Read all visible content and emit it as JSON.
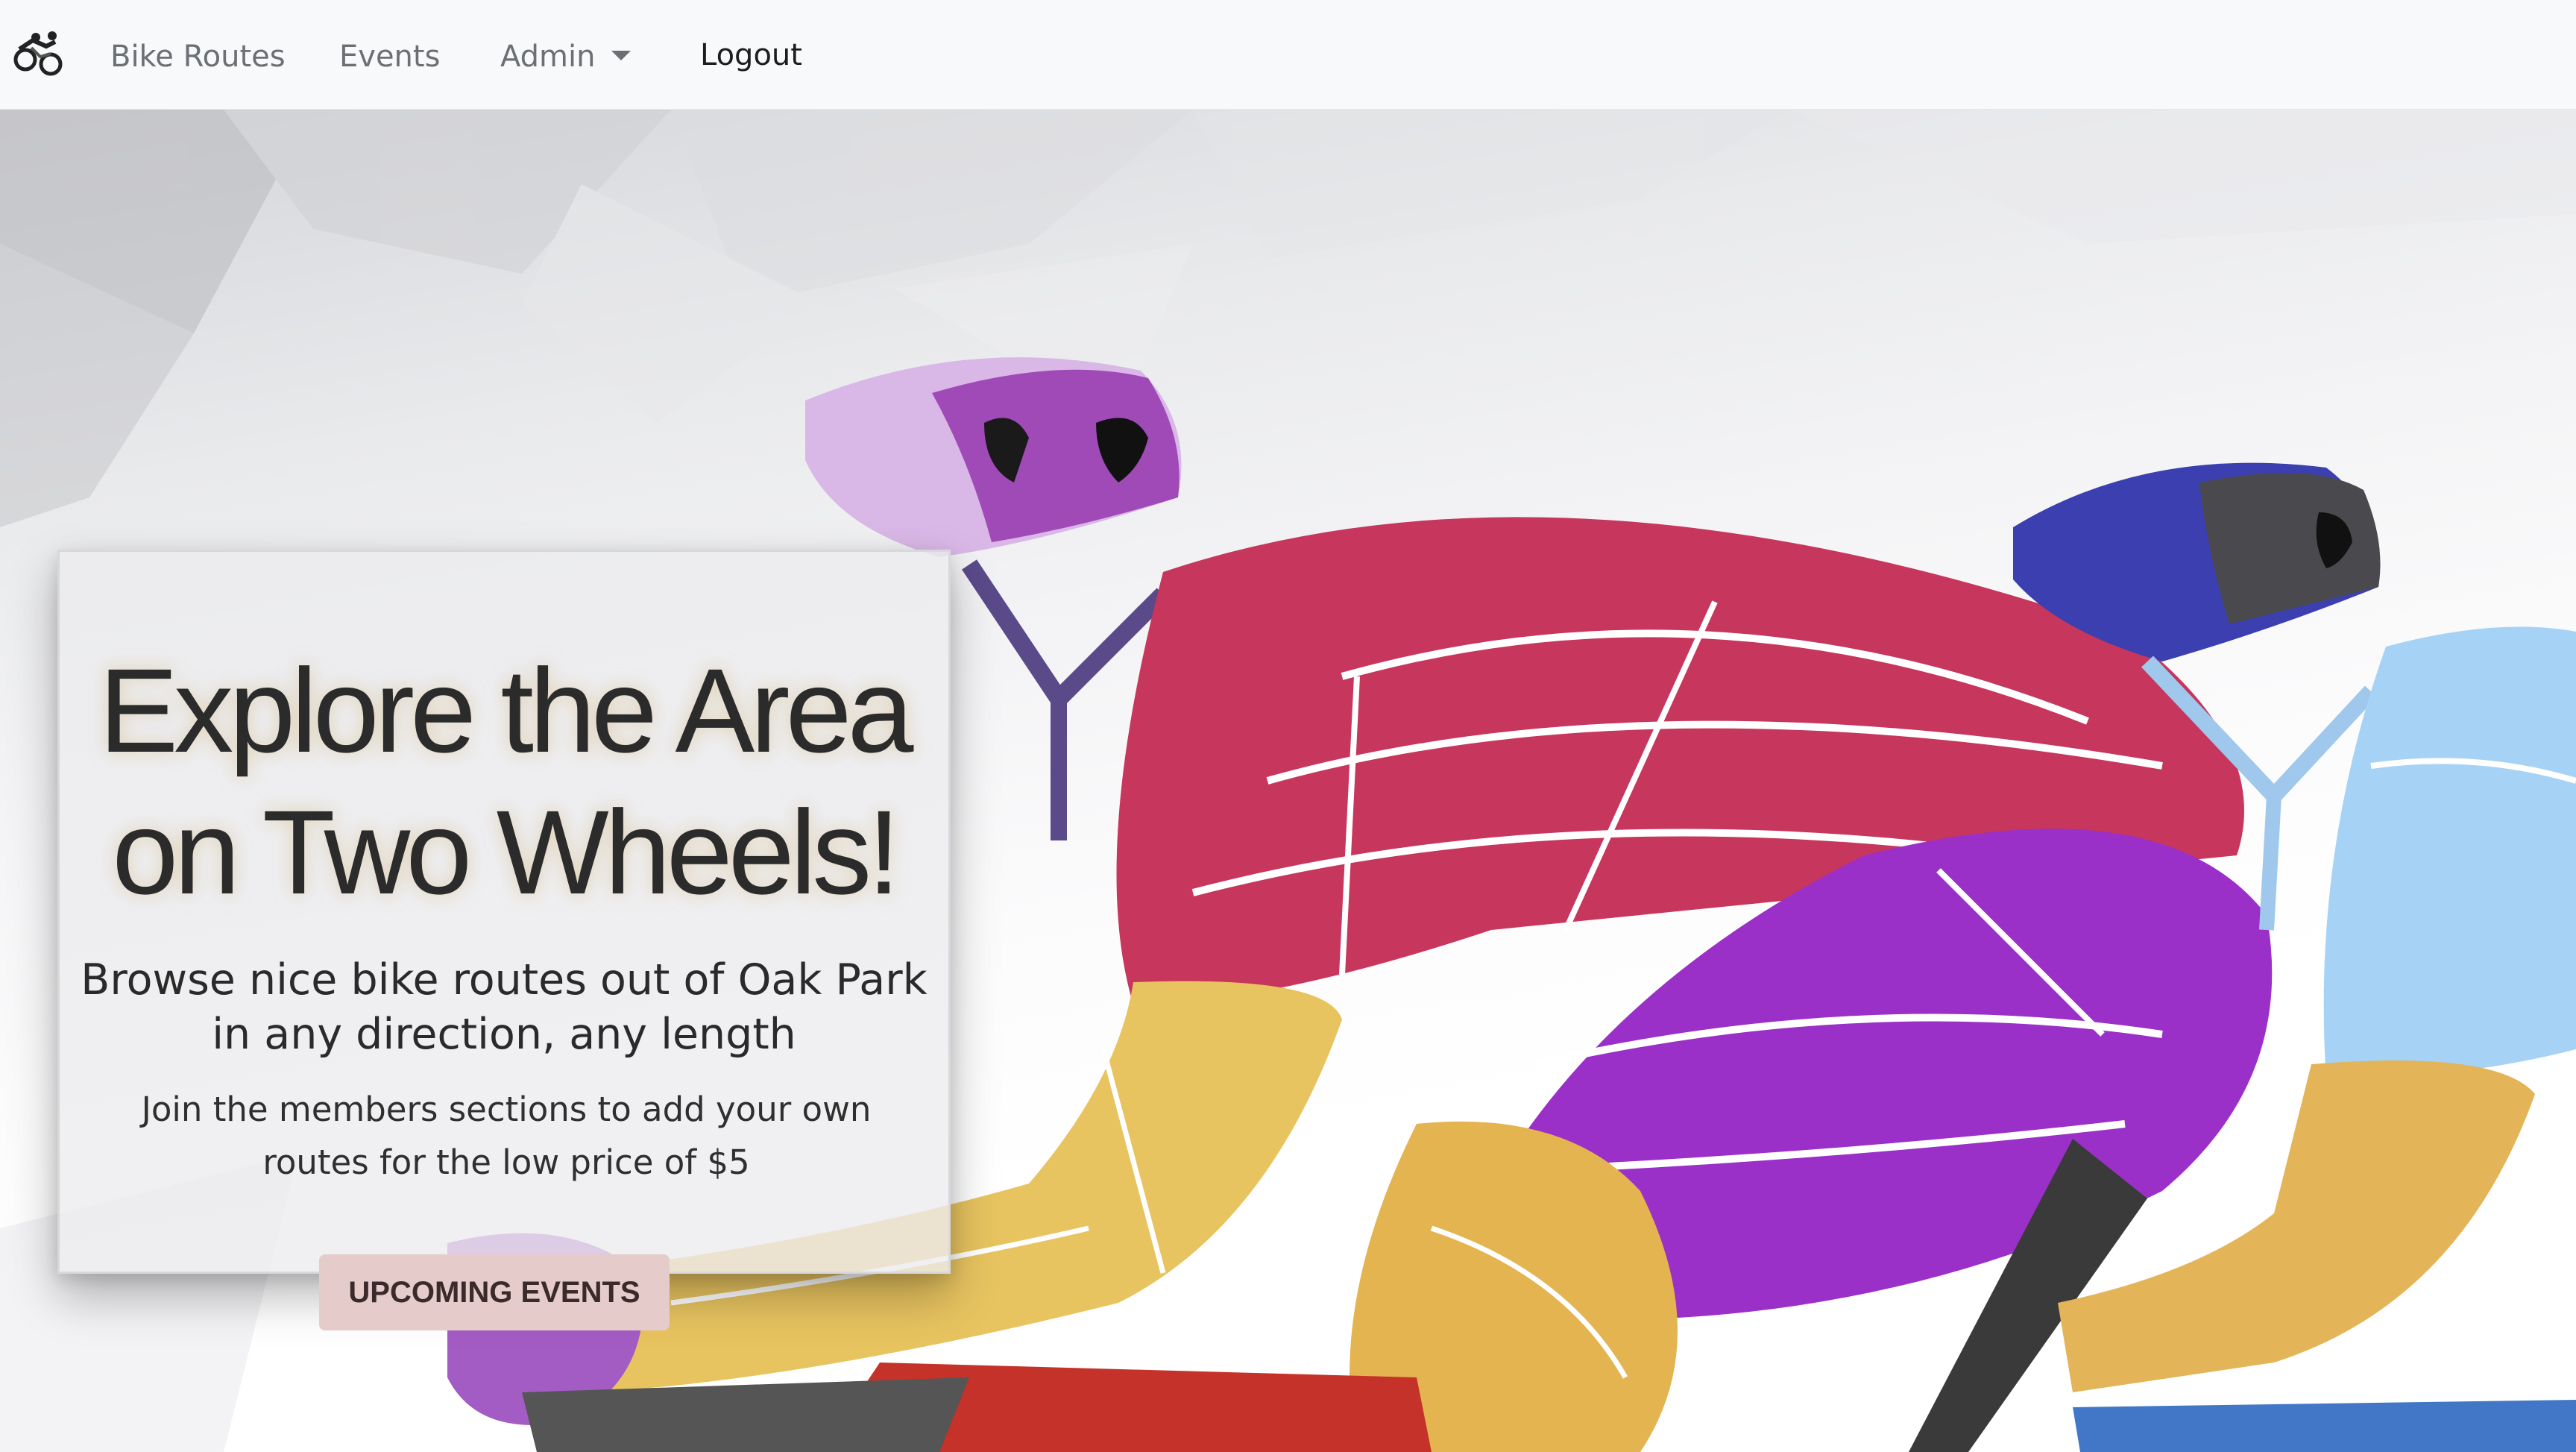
{
  "navbar": {
    "brand_icon": "cyclists-logo-icon",
    "links": {
      "bike_routes": "Bike Routes",
      "events": "Events",
      "admin": "Admin",
      "logout": "Logout"
    }
  },
  "hero": {
    "title": "Explore the Area on Two Wheels!",
    "lead": "Browse nice bike routes out of Oak Park in any direction, any length",
    "sub": "Join the members sections to add your own routes for the low price of $5",
    "cta_label": "UPCOMING EVENTS",
    "background": "stylized-cyclists-illustration"
  },
  "colors": {
    "navbar_bg": "#f8f9fa",
    "nav_text": "#6c6f73",
    "cta_bg": "#e6cbcb",
    "jersey_red": "#c2365a",
    "shorts_purple": "#9b30c8",
    "arm_yellow": "#e8c460",
    "helmet_blue": "#3b3fb0"
  }
}
